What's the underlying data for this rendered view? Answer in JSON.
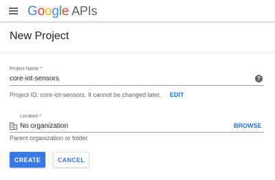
{
  "header": {
    "menu_icon": "hamburger-menu-icon",
    "brand_letters": [
      "G",
      "o",
      "o",
      "g",
      "l",
      "e"
    ],
    "brand_suffix": "APIs",
    "brand_colors": [
      "#4285f4",
      "#ea4335",
      "#fbbc05",
      "#4285f4",
      "#34a853",
      "#ea4335"
    ]
  },
  "page": {
    "title": "New Project"
  },
  "form": {
    "project_name": {
      "label": "Project Name *",
      "value": "core-iot-sensors",
      "help_icon": "help-circle-icon",
      "help_glyph": "?"
    },
    "project_id": {
      "text": "Project ID: core-iot-sensors. It cannot be changed later.",
      "edit_label": "EDIT"
    },
    "location": {
      "label": "Location *",
      "icon": "organization-building-icon",
      "value": "No organization",
      "browse_label": "BROWSE",
      "hint": "Parent organization or folder"
    }
  },
  "actions": {
    "create_label": "CREATE",
    "cancel_label": "CANCEL"
  },
  "colors": {
    "accent": "#3b78e7",
    "link": "#1a73e8"
  }
}
